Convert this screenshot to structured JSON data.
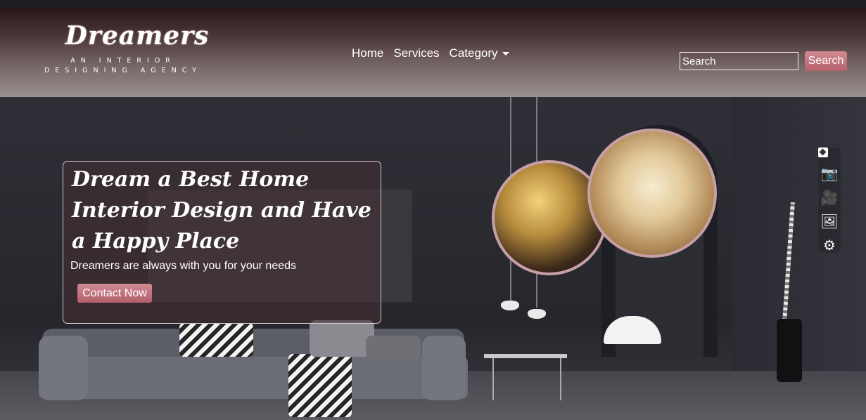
{
  "brand": {
    "name": "Dreamers",
    "tagline": "AN INTERIOR DESIGNING AGENCY"
  },
  "nav": {
    "items": [
      {
        "label": "Home"
      },
      {
        "label": "Services"
      },
      {
        "label": "Category"
      }
    ]
  },
  "search": {
    "placeholder": "Search",
    "button_label": "Search"
  },
  "hero": {
    "title": "Dream a Best Home Interior Design and Have a Happy Place",
    "subtitle": "Dreamers are always with you for your needs",
    "cta_label": "Contact Now"
  },
  "side_toolbar": {
    "icons": [
      "pin-icon",
      "camera-icon",
      "video-icon",
      "gallery-icon",
      "gear-icon"
    ]
  },
  "colors": {
    "accent": "#c07580",
    "circle_border": "#c6a0a6"
  }
}
